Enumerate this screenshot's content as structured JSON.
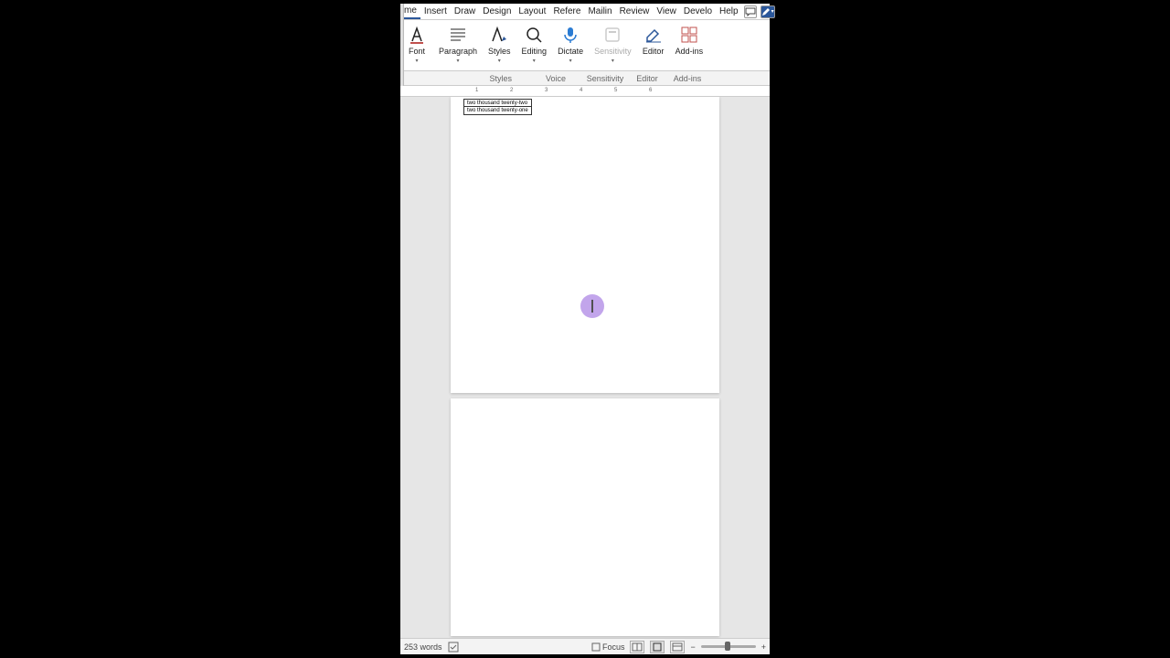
{
  "menu": {
    "items": [
      "me",
      "Insert",
      "Draw",
      "Design",
      "Layout",
      "Refere",
      "Mailin",
      "Review",
      "View",
      "Develo",
      "Help"
    ]
  },
  "ribbon": {
    "font": "Font",
    "paragraph": "Paragraph",
    "styles": "Styles",
    "editing": "Editing",
    "dictate": "Dictate",
    "sensitivity": "Sensitivity",
    "editor": "Editor",
    "addins": "Add-ins"
  },
  "group_labels": {
    "styles": "Styles",
    "voice": "Voice",
    "sensitivity": "Sensitivity",
    "editor": "Editor",
    "addins": "Add-ins"
  },
  "ruler": {
    "marks": [
      "1",
      "2",
      "3",
      "4",
      "5",
      "6"
    ]
  },
  "table": {
    "rows": [
      "two thousand twenty-two",
      "two thousand twenty-one"
    ]
  },
  "status": {
    "words": "253 words",
    "focus": "Focus"
  }
}
